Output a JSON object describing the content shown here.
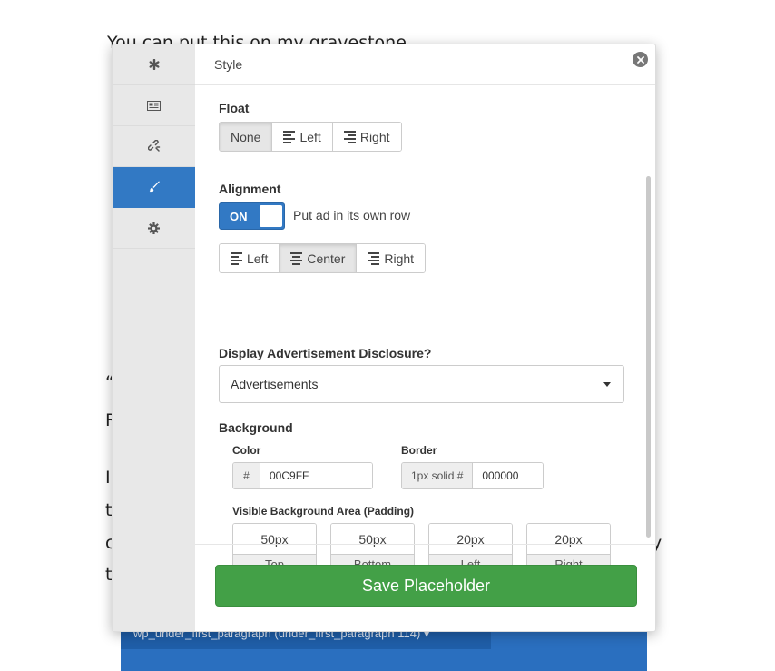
{
  "background_page": {
    "top_text": "You can put this on my gravestone",
    "fragments": [
      "“",
      "R",
      "I",
      "t",
      "c",
      "t",
      "y"
    ],
    "blue_bar_text": "wp_under_first_paragraph (under_first_paragraph 114) ▾"
  },
  "modal": {
    "title": "Style",
    "sidebar": {
      "items": [
        {
          "name": "asterisk-icon",
          "active": false
        },
        {
          "name": "ad-card-icon",
          "active": false
        },
        {
          "name": "unlink-icon",
          "active": false
        },
        {
          "name": "paintbrush-icon",
          "active": true
        },
        {
          "name": "gear-icon",
          "active": false
        }
      ]
    },
    "float": {
      "label": "Float",
      "options": [
        "None",
        "Left",
        "Right"
      ],
      "selected": "None"
    },
    "alignment": {
      "label": "Alignment",
      "toggle_state": "ON",
      "toggle_description": "Put ad in its own row",
      "options": [
        "Left",
        "Center",
        "Right"
      ],
      "selected": "Center"
    },
    "disclosure": {
      "label": "Display Advertisement Disclosure?",
      "selected_value": "Advertisements"
    },
    "background": {
      "label": "Background",
      "color_label": "Color",
      "color_prefix": "#",
      "color_value": "00C9FF",
      "border_label": "Border",
      "border_prefix": "1px solid #",
      "border_value": "000000",
      "padding_label": "Visible Background Area (Padding)",
      "padding": [
        {
          "value": "50px",
          "label": "Top"
        },
        {
          "value": "50px",
          "label": "Bottom"
        },
        {
          "value": "20px",
          "label": "Left"
        },
        {
          "value": "20px",
          "label": "Right"
        }
      ]
    },
    "save_label": "Save Placeholder"
  },
  "colors": {
    "accent": "#3279c4",
    "save": "#43a047"
  }
}
